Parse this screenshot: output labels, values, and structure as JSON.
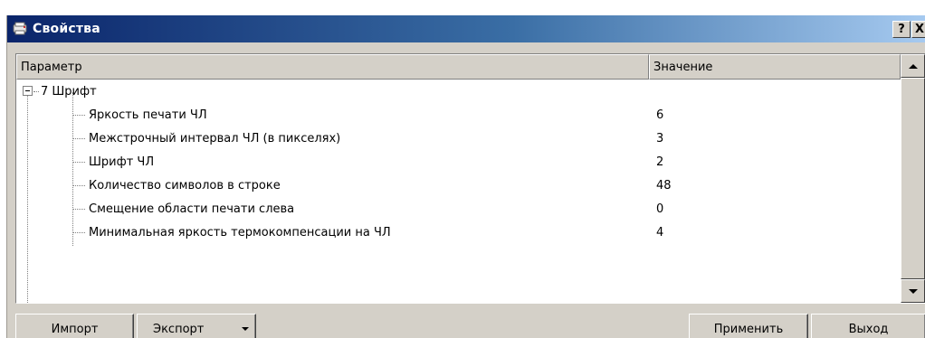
{
  "window": {
    "title": "Свойства",
    "help_label": "?",
    "close_label": "X"
  },
  "grid": {
    "columns": [
      "Параметр",
      "Значение"
    ],
    "group": {
      "label": "7 Шрифт",
      "rows": [
        {
          "name": "Яркость печати ЧЛ",
          "value": "6"
        },
        {
          "name": "Межстрочный интервал ЧЛ (в пикселях)",
          "value": "3"
        },
        {
          "name": "Шрифт ЧЛ",
          "value": "2"
        },
        {
          "name": "Количество символов в строке",
          "value": "48"
        },
        {
          "name": "Смещение области печати слева",
          "value": "0"
        },
        {
          "name": "Минимальная яркость термокомпенсации на ЧЛ",
          "value": "4"
        }
      ]
    }
  },
  "buttons": {
    "import": "Импорт",
    "export": "Экспорт",
    "apply": "Применить",
    "exit": "Выход"
  }
}
